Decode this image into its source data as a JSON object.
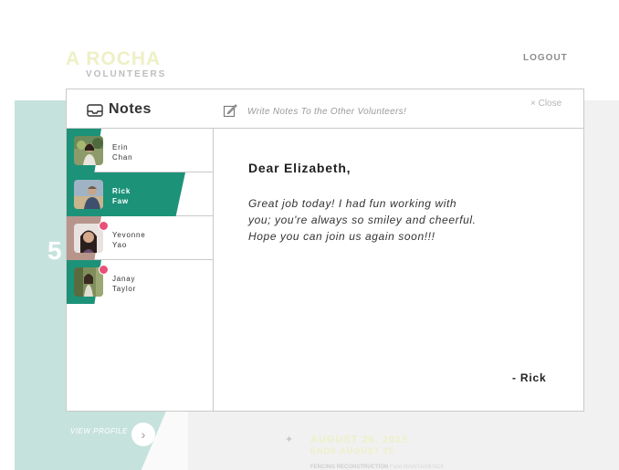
{
  "background": {
    "logo_main": "A ROCHA",
    "logo_sub": "VOLUNTEERS",
    "logout": "LOGOUT",
    "big_number": "5",
    "view_profile": "VIEW PROFILE",
    "event_date": "AUGUST 20, 2015",
    "event_ends": "ENDS AUGUST 25",
    "event_title": "FENCING RECONSTRUCTION",
    "event_subtitle": "Field MAINTAINENCE",
    "colors": {
      "teal_panel": "#c6e2dd",
      "logo_yellow": "#eef0c6"
    }
  },
  "modal": {
    "title": "Notes",
    "write_prompt": "Write Notes To the Other Volunteers!",
    "close": "× Close",
    "icons": {
      "title_icon": "inbox-tray-icon",
      "prompt_icon": "pencil-note-icon"
    }
  },
  "contacts": [
    {
      "first": "Erin",
      "last": "Chan",
      "active": false,
      "unread": false
    },
    {
      "first": "Rick",
      "last": "Faw",
      "active": true,
      "unread": false
    },
    {
      "first": "Yevonne",
      "last": "Yao",
      "active": false,
      "unread": true
    },
    {
      "first": "Janay",
      "last": "Taylor",
      "active": false,
      "unread": true
    }
  ],
  "note": {
    "greeting": "Dear Elizabeth,",
    "body": "Great job today! I had fun working with you; you're always so smiley and cheerful. Hope you can join us again soon!!!",
    "signature": "- Rick"
  },
  "colors": {
    "accent": "#1c9279",
    "unread_dot": "#e8507a",
    "muted_accent": "#b8958b"
  }
}
